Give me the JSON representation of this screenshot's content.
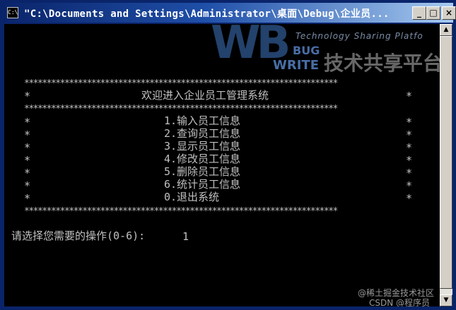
{
  "window": {
    "title": "\"C:\\Documents and Settings\\Administrator\\桌面\\Debug\\企业员...",
    "icon_text": "C:\\",
    "minimize": "_",
    "maximize": "□",
    "close": "×"
  },
  "console": {
    "stars": "**********************************************************************",
    "edge": "*",
    "welcome": "欢迎进入企业员工管理系统",
    "menu": [
      "1.输入员工信息",
      "2.查询员工信息",
      "3.显示员工信息",
      "4.修改员工信息",
      "5.删除员工信息",
      "6.统计员工信息",
      "0.退出系统"
    ],
    "prompt": "请选择您需要的操作(0-6):",
    "input_value": "1"
  },
  "watermark": {
    "letters": "WB",
    "bug": "BUG",
    "write": "WRITE",
    "tagline": "Technology Sharing Platfo",
    "cn": "技术共享平台",
    "bottom_line1": "@稀土掘金技术社区",
    "bottom_line2": "CSDN @程序员"
  },
  "colors": {
    "titlebar": "#0a246a",
    "console_bg": "#000000",
    "console_fg": "#c0c0c0"
  }
}
